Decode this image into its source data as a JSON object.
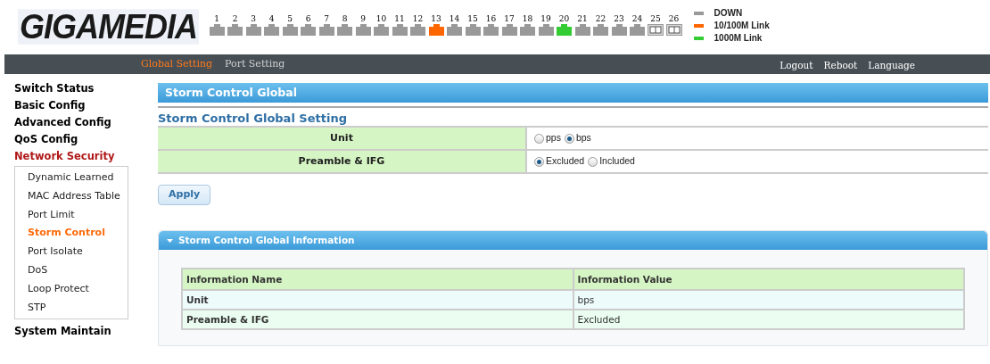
{
  "logo": {
    "text": "GIGAMEDIA"
  },
  "ports": [
    {
      "label": "1",
      "kind": "rj45",
      "color": "#999999"
    },
    {
      "label": "2",
      "kind": "rj45",
      "color": "#999999"
    },
    {
      "label": "3",
      "kind": "rj45",
      "color": "#999999"
    },
    {
      "label": "4",
      "kind": "rj45",
      "color": "#999999"
    },
    {
      "label": "5",
      "kind": "rj45",
      "color": "#999999"
    },
    {
      "label": "6",
      "kind": "rj45",
      "color": "#999999"
    },
    {
      "label": "7",
      "kind": "rj45",
      "color": "#999999"
    },
    {
      "label": "8",
      "kind": "rj45",
      "color": "#999999"
    },
    {
      "label": "9",
      "kind": "rj45",
      "color": "#999999"
    },
    {
      "label": "10",
      "kind": "rj45",
      "color": "#999999"
    },
    {
      "label": "11",
      "kind": "rj45",
      "color": "#999999"
    },
    {
      "label": "12",
      "kind": "rj45",
      "color": "#999999"
    },
    {
      "label": "13",
      "kind": "rj45",
      "color": "#ff6600"
    },
    {
      "label": "14",
      "kind": "rj45",
      "color": "#999999"
    },
    {
      "label": "15",
      "kind": "rj45",
      "color": "#999999"
    },
    {
      "label": "16",
      "kind": "rj45",
      "color": "#999999"
    },
    {
      "label": "17",
      "kind": "rj45",
      "color": "#999999"
    },
    {
      "label": "18",
      "kind": "rj45",
      "color": "#999999"
    },
    {
      "label": "19",
      "kind": "rj45",
      "color": "#999999"
    },
    {
      "label": "20",
      "kind": "rj45",
      "color": "#33cc33"
    },
    {
      "label": "21",
      "kind": "rj45",
      "color": "#999999"
    },
    {
      "label": "22",
      "kind": "rj45",
      "color": "#999999"
    },
    {
      "label": "23",
      "kind": "rj45",
      "color": "#999999"
    },
    {
      "label": "24",
      "kind": "rj45",
      "color": "#999999"
    },
    {
      "label": "25",
      "kind": "sfp",
      "color": "#999999"
    },
    {
      "label": "26",
      "kind": "sfp",
      "color": "#999999"
    }
  ],
  "legend": [
    {
      "label": "DOWN",
      "color": "#999999"
    },
    {
      "label": "10/100M Link",
      "color": "#ff6600"
    },
    {
      "label": "1000M Link",
      "color": "#33cc33"
    }
  ],
  "nav": {
    "tabs": [
      {
        "label": "Global Setting",
        "selected": true
      },
      {
        "label": "Port Setting",
        "selected": false
      }
    ],
    "links": [
      "Logout",
      "Reboot",
      "Language"
    ]
  },
  "sidebar": {
    "items": [
      {
        "label": "Switch Status",
        "selected": false
      },
      {
        "label": "Basic Config",
        "selected": false
      },
      {
        "label": "Advanced Config",
        "selected": false
      },
      {
        "label": "QoS Config",
        "selected": false
      },
      {
        "label": "Network Security",
        "selected": true,
        "children": [
          {
            "label": "Dynamic Learned",
            "selected": false
          },
          {
            "label": "MAC Address Table",
            "selected": false
          },
          {
            "label": "Port Limit",
            "selected": false
          },
          {
            "label": "Storm Control",
            "selected": true
          },
          {
            "label": "Port Isolate",
            "selected": false
          },
          {
            "label": "DoS",
            "selected": false
          },
          {
            "label": "Loop Protect",
            "selected": false
          },
          {
            "label": "STP",
            "selected": false
          }
        ]
      },
      {
        "label": "System Maintain",
        "selected": false
      }
    ]
  },
  "panel": {
    "title": "Storm Control Global"
  },
  "setting": {
    "title": "Storm Control Global Setting",
    "rows": [
      {
        "label": "Unit",
        "options": [
          {
            "label": "pps",
            "selected": false
          },
          {
            "label": "bps",
            "selected": true
          }
        ]
      },
      {
        "label": "Preamble & IFG",
        "options": [
          {
            "label": "Excluded",
            "selected": true
          },
          {
            "label": "Included",
            "selected": false
          }
        ]
      }
    ],
    "apply": "Apply"
  },
  "info": {
    "title": "Storm Control Global Information",
    "expanded": true,
    "columns": [
      "Information Name",
      "Information Value"
    ],
    "rows": [
      [
        "Unit",
        "bps"
      ],
      [
        "Preamble & IFG",
        "Excluded"
      ]
    ]
  }
}
